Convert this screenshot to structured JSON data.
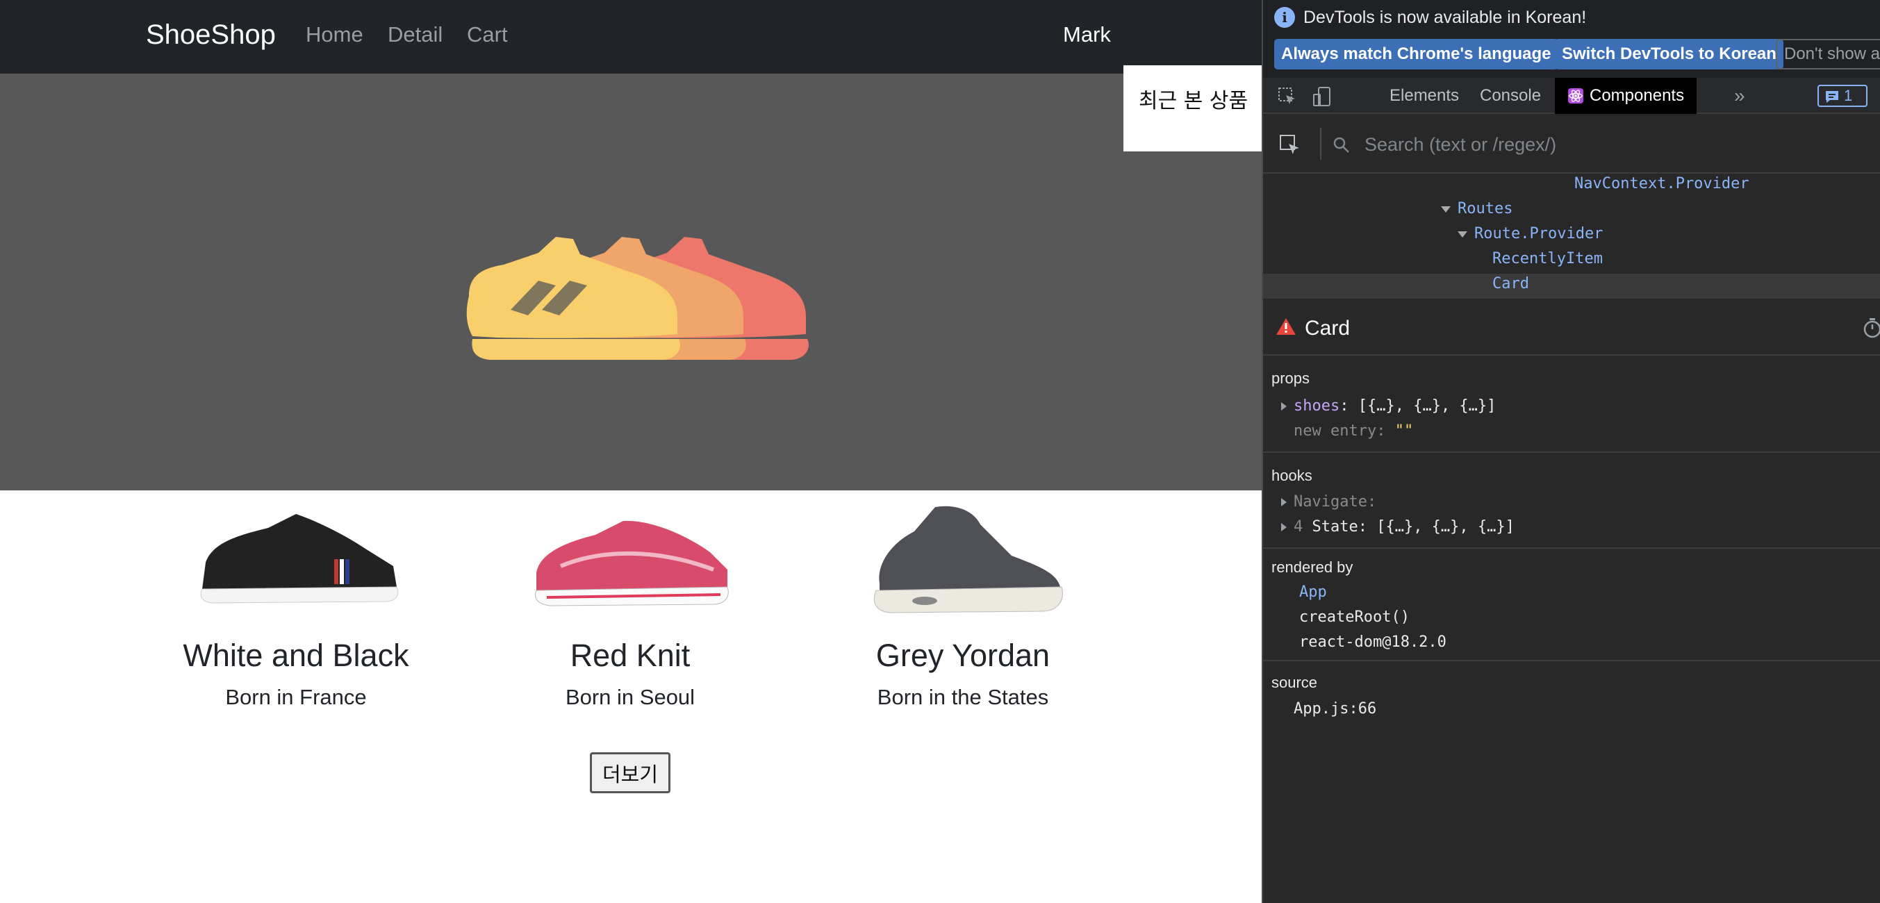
{
  "app": {
    "brand": "ShoeShop",
    "nav": [
      "Home",
      "Detail",
      "Cart"
    ],
    "user": "Mark",
    "recent_label": "최근 본 상품",
    "more_button": "더보기",
    "cards": [
      {
        "title": "White and Black",
        "subtitle": "Born in France"
      },
      {
        "title": "Red Knit",
        "subtitle": "Born in Seoul"
      },
      {
        "title": "Grey Yordan",
        "subtitle": "Born in the States"
      }
    ]
  },
  "devtools": {
    "banner": {
      "message": "DevTools is now available in Korean!",
      "btn_match": "Always match Chrome's language",
      "btn_switch": "Switch DevTools to Korean",
      "btn_dont": "Don't show a"
    },
    "tabs": {
      "elements": "Elements",
      "console": "Console",
      "components": "Components",
      "issues_count": "1"
    },
    "search_placeholder": "Search (text or /regex/)",
    "tree": {
      "nav_provider": "NavContext.Provider",
      "routes": "Routes",
      "route_provider": "Route.Provider",
      "recently_item": "RecentlyItem",
      "card": "Card"
    },
    "inspector": {
      "component": "Card",
      "props_title": "props",
      "prop_shoes_key": "shoes",
      "prop_shoes_value": "[{…}, {…}, {…}]",
      "prop_new_key": "new entry",
      "prop_new_value": "\"\"",
      "hooks_title": "hooks",
      "hook_navigate": "Navigate:",
      "hook_state_index": "4",
      "hook_state": "State: [{…}, {…}, {…}]",
      "rendered_title": "rendered by",
      "rendered_app": "App",
      "rendered_root": "createRoot()",
      "rendered_dom": "react-dom@18.2.0",
      "source_title": "source",
      "source_file": "App.js:66"
    }
  },
  "colors": {
    "navbar": "#212529",
    "hero": "#585858",
    "shoe_yellow": "#f8cf6a",
    "shoe_orange": "#f0a56a",
    "shoe_red": "#ec776a",
    "devtools_bg": "#282828",
    "accent_blue": "#3c6fb5"
  }
}
